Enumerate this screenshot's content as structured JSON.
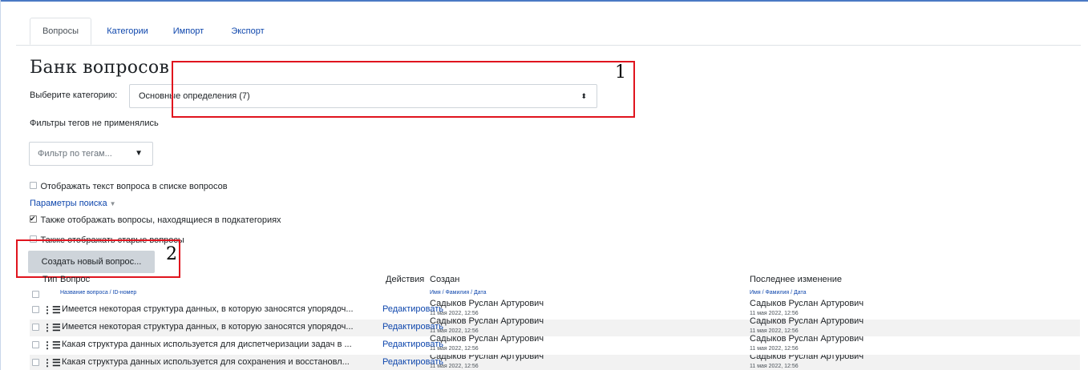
{
  "tabs": [
    "Вопросы",
    "Категории",
    "Импорт",
    "Экспорт"
  ],
  "page_title": "Банк вопросов",
  "category": {
    "label": "Выберите категорию:",
    "selected": "Основные определения (7)"
  },
  "tag_filter": {
    "note": "Фильтры тегов не применялись",
    "placeholder": "Фильтр по тегам...",
    "arrow": "▼"
  },
  "options": {
    "show_text": "Отображать текст вопроса в списке вопросов",
    "search_params": "Параметры поиска",
    "include_subcats": "Также отображать вопросы, находящиеся в подкатегориях",
    "show_old": "Также отображать старые вопросы"
  },
  "create_button": "Создать новый вопрос...",
  "annotations": [
    "1",
    "2"
  ],
  "table": {
    "headers": {
      "type": "Тип",
      "question": "Вопрос",
      "question_sub": "Название вопроса / ID-номер",
      "actions": "Действия",
      "created": "Создан",
      "created_sub": "Имя / Фамилия / Дата",
      "modified": "Последнее изменение",
      "modified_sub": "Имя / Фамилия / Дата"
    },
    "rows": [
      {
        "question": "Имеется некоторая структура данных, в которую заносятся упорядоч...",
        "action": "Редактировать",
        "created_by": "Садыков Руслан Артурович",
        "created_date": "11 мая 2022, 12:56",
        "modified_by": "Садыков Руслан Артурович",
        "modified_date": "11 мая 2022, 12:56"
      },
      {
        "question": "Имеется некоторая структура данных, в которую заносятся упорядоч...",
        "action": "Редактировать",
        "created_by": "Садыков Руслан Артурович",
        "created_date": "11 мая 2022, 12:56",
        "modified_by": "Садыков Руслан Артурович",
        "modified_date": "11 мая 2022, 12:56"
      },
      {
        "question": "Какая структура данных используется для диспетчеризации задач в ...",
        "action": "Редактировать",
        "created_by": "Садыков Руслан Артурович",
        "created_date": "11 мая 2022, 12:56",
        "modified_by": "Садыков Руслан Артурович",
        "modified_date": "11 мая 2022, 12:56"
      },
      {
        "question": "Какая структура данных используется для сохранения и восстановл...",
        "action": "Редактировать",
        "created_by": "Садыков Руслан Артурович",
        "created_date": "11 мая 2022, 12:56",
        "modified_by": "Садыков Руслан Артурович",
        "modified_date": "11 мая 2022, 12:56"
      }
    ]
  },
  "colors": {
    "link": "#0f47ad",
    "annotation_box": "#e0141e",
    "button": "#ced4da"
  }
}
